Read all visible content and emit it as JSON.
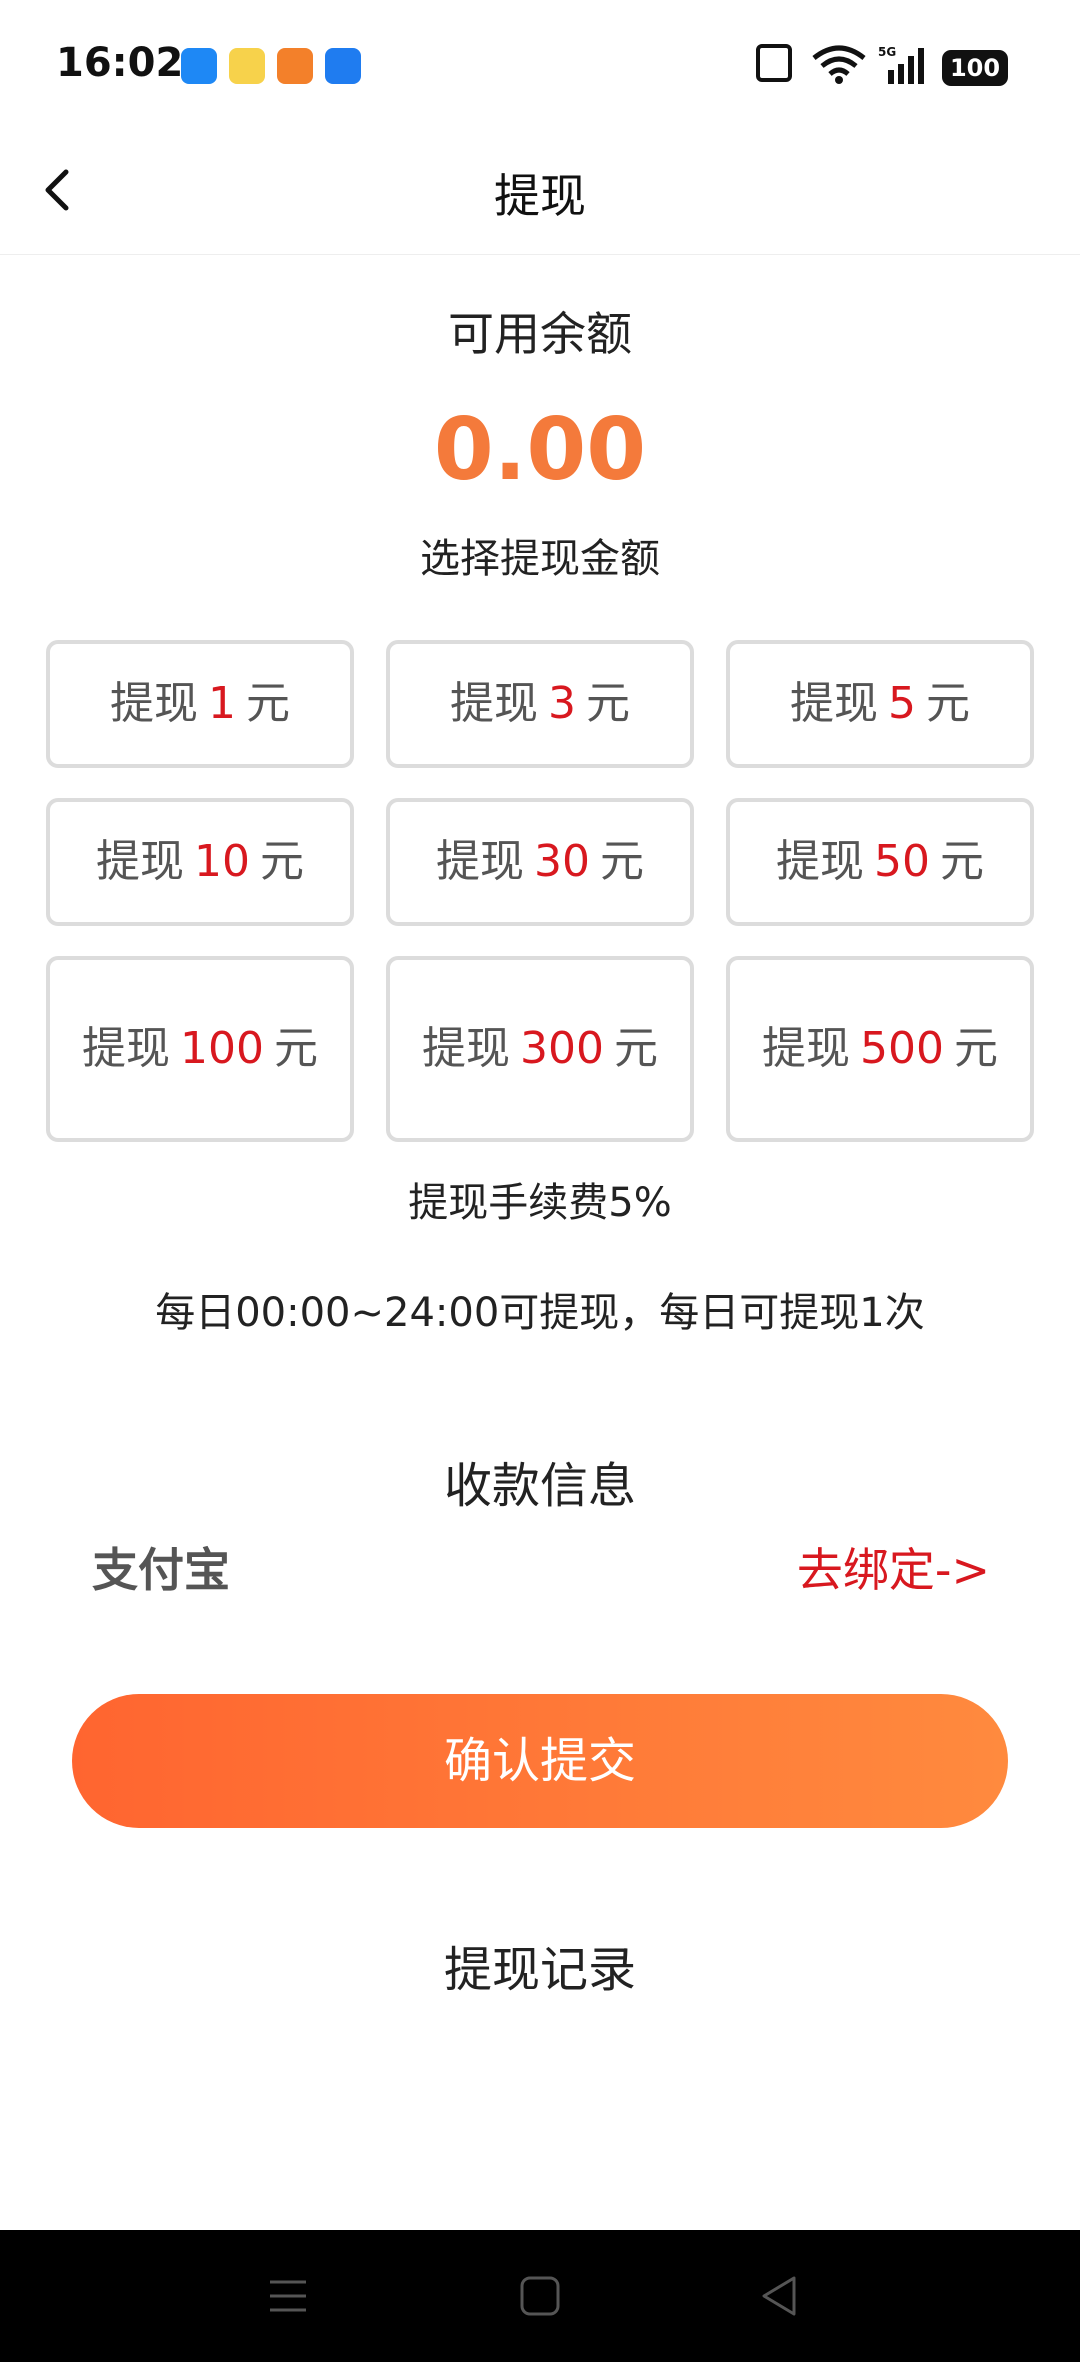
{
  "status_bar": {
    "time": "16:02",
    "battery": "100",
    "network": "5G"
  },
  "header": {
    "title": "提现"
  },
  "balance": {
    "label": "可用余额",
    "amount": "0.00"
  },
  "choose_label": "选择提现金额",
  "options": [
    {
      "prefix": "提现",
      "amount": "1",
      "unit": "元"
    },
    {
      "prefix": "提现",
      "amount": "3",
      "unit": "元"
    },
    {
      "prefix": "提现",
      "amount": "5",
      "unit": "元"
    },
    {
      "prefix": "提现",
      "amount": "10",
      "unit": "元"
    },
    {
      "prefix": "提现",
      "amount": "30",
      "unit": "元"
    },
    {
      "prefix": "提现",
      "amount": "50",
      "unit": "元"
    },
    {
      "prefix": "提现",
      "amount": "100",
      "unit": "元"
    },
    {
      "prefix": "提现",
      "amount": "300",
      "unit": "元"
    },
    {
      "prefix": "提现",
      "amount": "500",
      "unit": "元"
    }
  ],
  "fee_note": "提现手续费5%",
  "hours_note": "每日00:00~24:00可提现，每日可提现1次",
  "receiving": {
    "title": "收款信息",
    "method": "支付宝",
    "bind_link": "去绑定->"
  },
  "submit_label": "确认提交",
  "records_link": "提现记录",
  "colors": {
    "accent_orange": "#f47a3b",
    "amount_red": "#d8181f",
    "button_gradient_start": "#ff6530",
    "button_gradient_end": "#ff8a3e"
  }
}
